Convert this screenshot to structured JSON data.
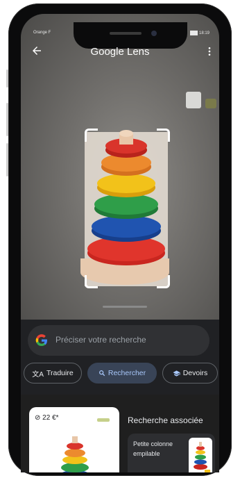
{
  "status_bar": {
    "carrier": "Orange F",
    "time": "18:19"
  },
  "topbar": {
    "title_google": "Google",
    "title_lens": "Lens",
    "back_icon": "arrow-back-icon",
    "menu_icon": "more-vert-icon"
  },
  "search": {
    "placeholder": "Préciser votre recherche"
  },
  "chips": [
    {
      "label": "Traduire",
      "icon": "translate-icon"
    },
    {
      "label": "Rechercher",
      "icon": "search-icon"
    },
    {
      "label": "Devoirs",
      "icon": "school-icon"
    }
  ],
  "result": {
    "price": "22 €*"
  },
  "related": {
    "title": "Recherche associée",
    "item_label": "Petite colonne empilable"
  },
  "colors": {
    "red": "#d9342b",
    "orange": "#e8892c",
    "yellow": "#f2c21a",
    "green": "#2e9b47",
    "blue": "#1f4ea6",
    "active_chip_bg": "#394457"
  }
}
